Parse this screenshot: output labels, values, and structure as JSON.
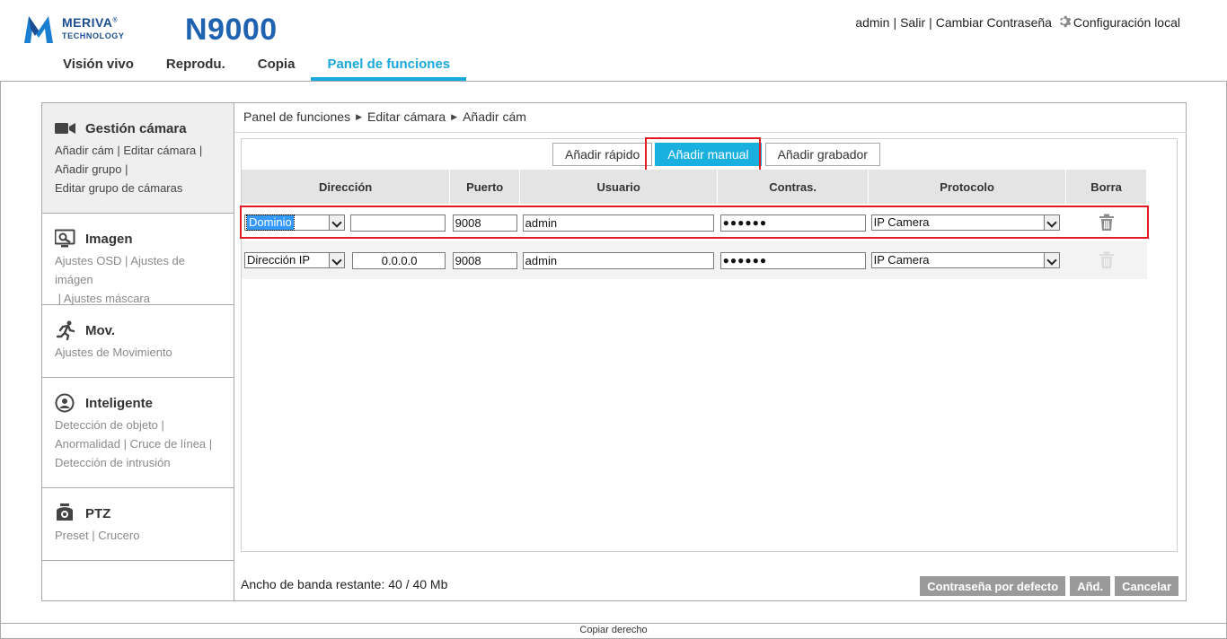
{
  "brand": {
    "name": "MERIVA",
    "registered": "®",
    "sub": "TECHNOLOGY",
    "model": "N9000",
    "color": "#1b4d91"
  },
  "header": {
    "user": "admin",
    "logout": "Salir",
    "change_password": "Cambiar Contraseña",
    "local_config": "Configuración local",
    "local_config_icon": "gear-icon"
  },
  "nav": {
    "tabs": [
      "Visión vivo",
      "Reprodu.",
      "Copia",
      "Panel de funciones"
    ],
    "active": "Panel de funciones",
    "accent": "#19a8d9"
  },
  "sidebar": {
    "sections": [
      {
        "title": "Gestión cámara",
        "icon": "video-camera-icon",
        "links": [
          "Añadir cám",
          "Editar cámara",
          "Añadir grupo",
          "Editar grupo de cámaras"
        ],
        "active": true
      },
      {
        "title": "Imagen",
        "icon": "monitor-settings-icon",
        "links": [
          "Ajustes OSD",
          "Ajustes de imágen",
          "Ajustes máscara"
        ]
      },
      {
        "title": "Mov.",
        "icon": "running-person-icon",
        "links": [
          "Ajustes de Movimiento"
        ]
      },
      {
        "title": "Inteligente",
        "icon": "smart-analysis-icon",
        "links": [
          "Detección de objeto",
          "Anormalidad",
          "Cruce de línea",
          "Detección de intrusión"
        ]
      },
      {
        "title": "PTZ",
        "icon": "ptz-camera-icon",
        "links": [
          "Preset",
          "Crucero"
        ]
      }
    ]
  },
  "breadcrumb": [
    "Panel de funciones",
    "Editar cámara",
    "Añadir cám"
  ],
  "tabs": {
    "items": [
      "Añadir rápido",
      "Añadir manual",
      "Añadir grabador"
    ],
    "active": "Añadir manual"
  },
  "table": {
    "headers": [
      "Dirección",
      "Puerto",
      "Usuario",
      "Contras.",
      "Protocolo",
      "Borra"
    ],
    "rows": [
      {
        "address_type": "Dominio",
        "address": "",
        "port": "9008",
        "user": "admin",
        "password": "●●●●●●",
        "protocol": "IP Camera"
      },
      {
        "address_type": "Dirección IP",
        "address": "0.0.0.0",
        "port": "9008",
        "user": "admin",
        "password": "●●●●●●",
        "protocol": "IP Camera"
      }
    ]
  },
  "bandwidth": "Ancho de banda restante: 40 / 40 Mb",
  "buttons": {
    "default_password": "Contraseña por defecto",
    "add": "Añd.",
    "cancel": "Cancelar"
  },
  "footer": "Copiar derecho"
}
